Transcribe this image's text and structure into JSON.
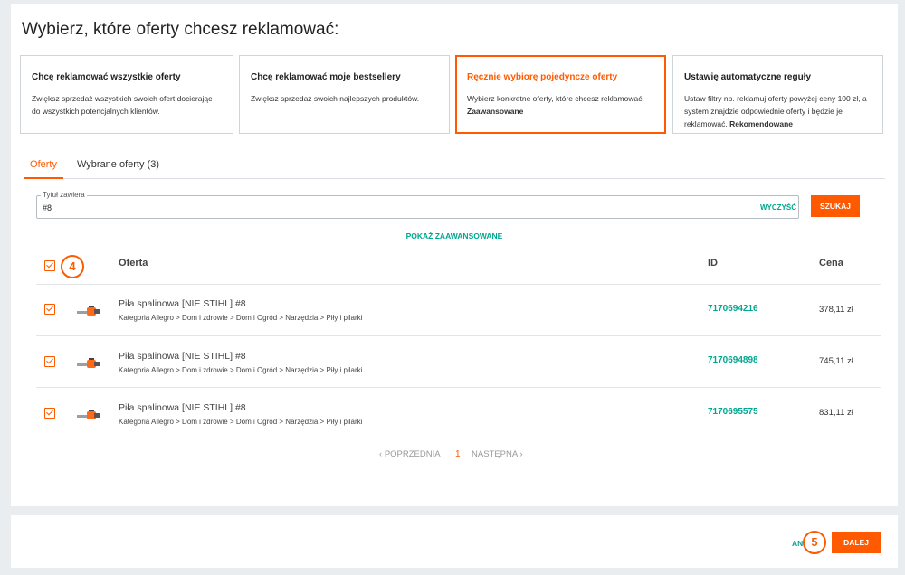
{
  "page": {
    "title": "Wybierz, które oferty chcesz reklamować:"
  },
  "options": [
    {
      "title": "Chcę reklamować wszystkie oferty",
      "desc": "Zwiększ sprzedaż wszystkich swoich ofert docierając do wszystkich potencjalnych klientów.",
      "tag": ""
    },
    {
      "title": "Chcę reklamować moje bestsellery",
      "desc": "Zwiększ sprzedaż swoich najlepszych produktów.",
      "tag": ""
    },
    {
      "title": "Ręcznie wybiorę pojedyncze oferty",
      "desc": "Wybierz konkretne oferty, które chcesz reklamować.",
      "tag": "Zaawansowane"
    },
    {
      "title": "Ustawię automatyczne reguły",
      "desc": "Ustaw filtry np. reklamuj oferty powyżej ceny 100 zł, a system znajdzie odpowiednie oferty i będzie je reklamować.",
      "tag": "Rekomendowane"
    }
  ],
  "tabs": [
    {
      "label": "Oferty"
    },
    {
      "label": "Wybrane oferty (3)"
    }
  ],
  "search": {
    "label": "Tytuł zawiera",
    "value": "#8",
    "clear_label": "WYCZYŚĆ",
    "button_label": "SZUKAJ"
  },
  "advanced_label": "POKAŻ ZAAWANSOWANE",
  "table": {
    "headers": {
      "offer": "Oferta",
      "id": "ID",
      "price": "Cena"
    },
    "rows": [
      {
        "title": "Piła spalinowa [NIE STIHL] #8",
        "category": "Kategoria Allegro > Dom i zdrowie > Dom i Ogród > Narzędzia > Piły i pilarki",
        "id": "7170694216",
        "price": "378,11 zł"
      },
      {
        "title": "Piła spalinowa [NIE STIHL] #8",
        "category": "Kategoria Allegro > Dom i zdrowie > Dom i Ogród > Narzędzia > Piły i pilarki",
        "id": "7170694898",
        "price": "745,11 zł"
      },
      {
        "title": "Piła spalinowa [NIE STIHL] #8",
        "category": "Kategoria Allegro > Dom i zdrowie > Dom i Ogród > Narzędzia > Piły i pilarki",
        "id": "7170695575",
        "price": "831,11 zł"
      }
    ]
  },
  "pagination": {
    "prev": "POPRZEDNIA",
    "current": "1",
    "next": "NASTĘPNA",
    "prev_icon": "chevron-left-icon",
    "next_icon": "chevron-right-icon"
  },
  "steps": {
    "select_all": "4",
    "next": "5"
  },
  "footer": {
    "cancel_label": "AN",
    "next_label": "DALEJ"
  },
  "colors": {
    "accent": "#ff5a00",
    "link": "#00a790"
  }
}
